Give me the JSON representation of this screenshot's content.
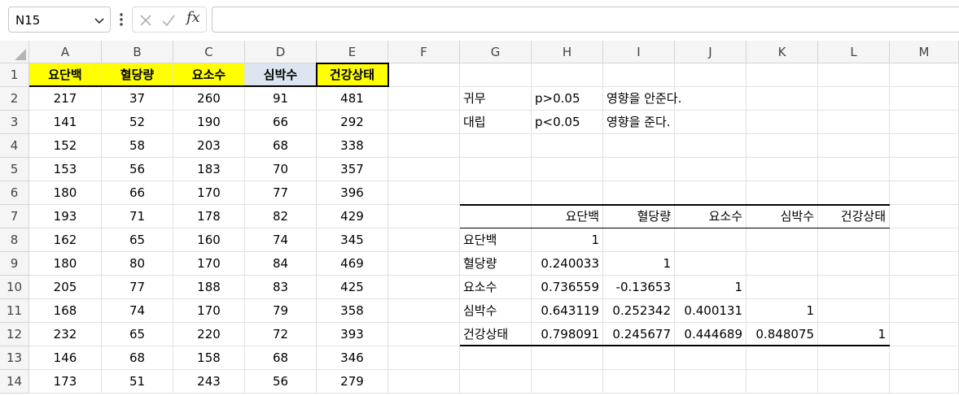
{
  "formula_bar": {
    "name_box": "N15",
    "fx_label": "fx",
    "formula": ""
  },
  "columns": [
    "A",
    "B",
    "C",
    "D",
    "E",
    "F",
    "G",
    "H",
    "I",
    "J",
    "K",
    "L",
    "M"
  ],
  "rows": [
    "1",
    "2",
    "3",
    "4",
    "5",
    "6",
    "7",
    "8",
    "9",
    "10",
    "11",
    "12",
    "13",
    "14"
  ],
  "data_headers": [
    "요단백",
    "혈당량",
    "요소수",
    "심박수",
    "건강상태"
  ],
  "data_rows": [
    [
      "217",
      "37",
      "260",
      "91",
      "481"
    ],
    [
      "141",
      "52",
      "190",
      "66",
      "292"
    ],
    [
      "152",
      "58",
      "203",
      "68",
      "338"
    ],
    [
      "153",
      "56",
      "183",
      "70",
      "357"
    ],
    [
      "180",
      "66",
      "170",
      "77",
      "396"
    ],
    [
      "193",
      "71",
      "178",
      "82",
      "429"
    ],
    [
      "162",
      "65",
      "160",
      "74",
      "345"
    ],
    [
      "180",
      "80",
      "170",
      "84",
      "469"
    ],
    [
      "205",
      "77",
      "188",
      "83",
      "425"
    ],
    [
      "168",
      "74",
      "170",
      "79",
      "358"
    ],
    [
      "232",
      "65",
      "220",
      "72",
      "393"
    ],
    [
      "146",
      "68",
      "158",
      "68",
      "346"
    ],
    [
      "173",
      "51",
      "243",
      "56",
      "279"
    ]
  ],
  "hypothesis": [
    [
      "귀무",
      "p>0.05",
      "영향을 안준다."
    ],
    [
      "대립",
      "p<0.05",
      "영향을 준다."
    ]
  ],
  "correlation": {
    "headers": [
      "요단백",
      "혈당량",
      "요소수",
      "심박수",
      "건강상태"
    ],
    "rows": [
      {
        "label": "요단백",
        "values": [
          "1",
          "",
          "",
          "",
          ""
        ]
      },
      {
        "label": "혈당량",
        "values": [
          "0.240033",
          "1",
          "",
          "",
          ""
        ]
      },
      {
        "label": "요소수",
        "values": [
          "0.736559",
          "-0.13653",
          "1",
          "",
          ""
        ]
      },
      {
        "label": "심박수",
        "values": [
          "0.643119",
          "0.252342",
          "0.400131",
          "1",
          ""
        ]
      },
      {
        "label": "건강상태",
        "values": [
          "0.798091",
          "0.245677",
          "0.444689",
          "0.848075",
          "1"
        ]
      }
    ]
  },
  "colors": {
    "header_yellow": "#ffff00",
    "header_blue": "#dde6f0",
    "grid_line": "#e1e1e1",
    "header_bg": "#f5f5f5"
  },
  "icons": [
    "chevron-down-icon",
    "more-vert-icon",
    "cancel-x-icon",
    "confirm-check-icon",
    "fx-icon"
  ]
}
